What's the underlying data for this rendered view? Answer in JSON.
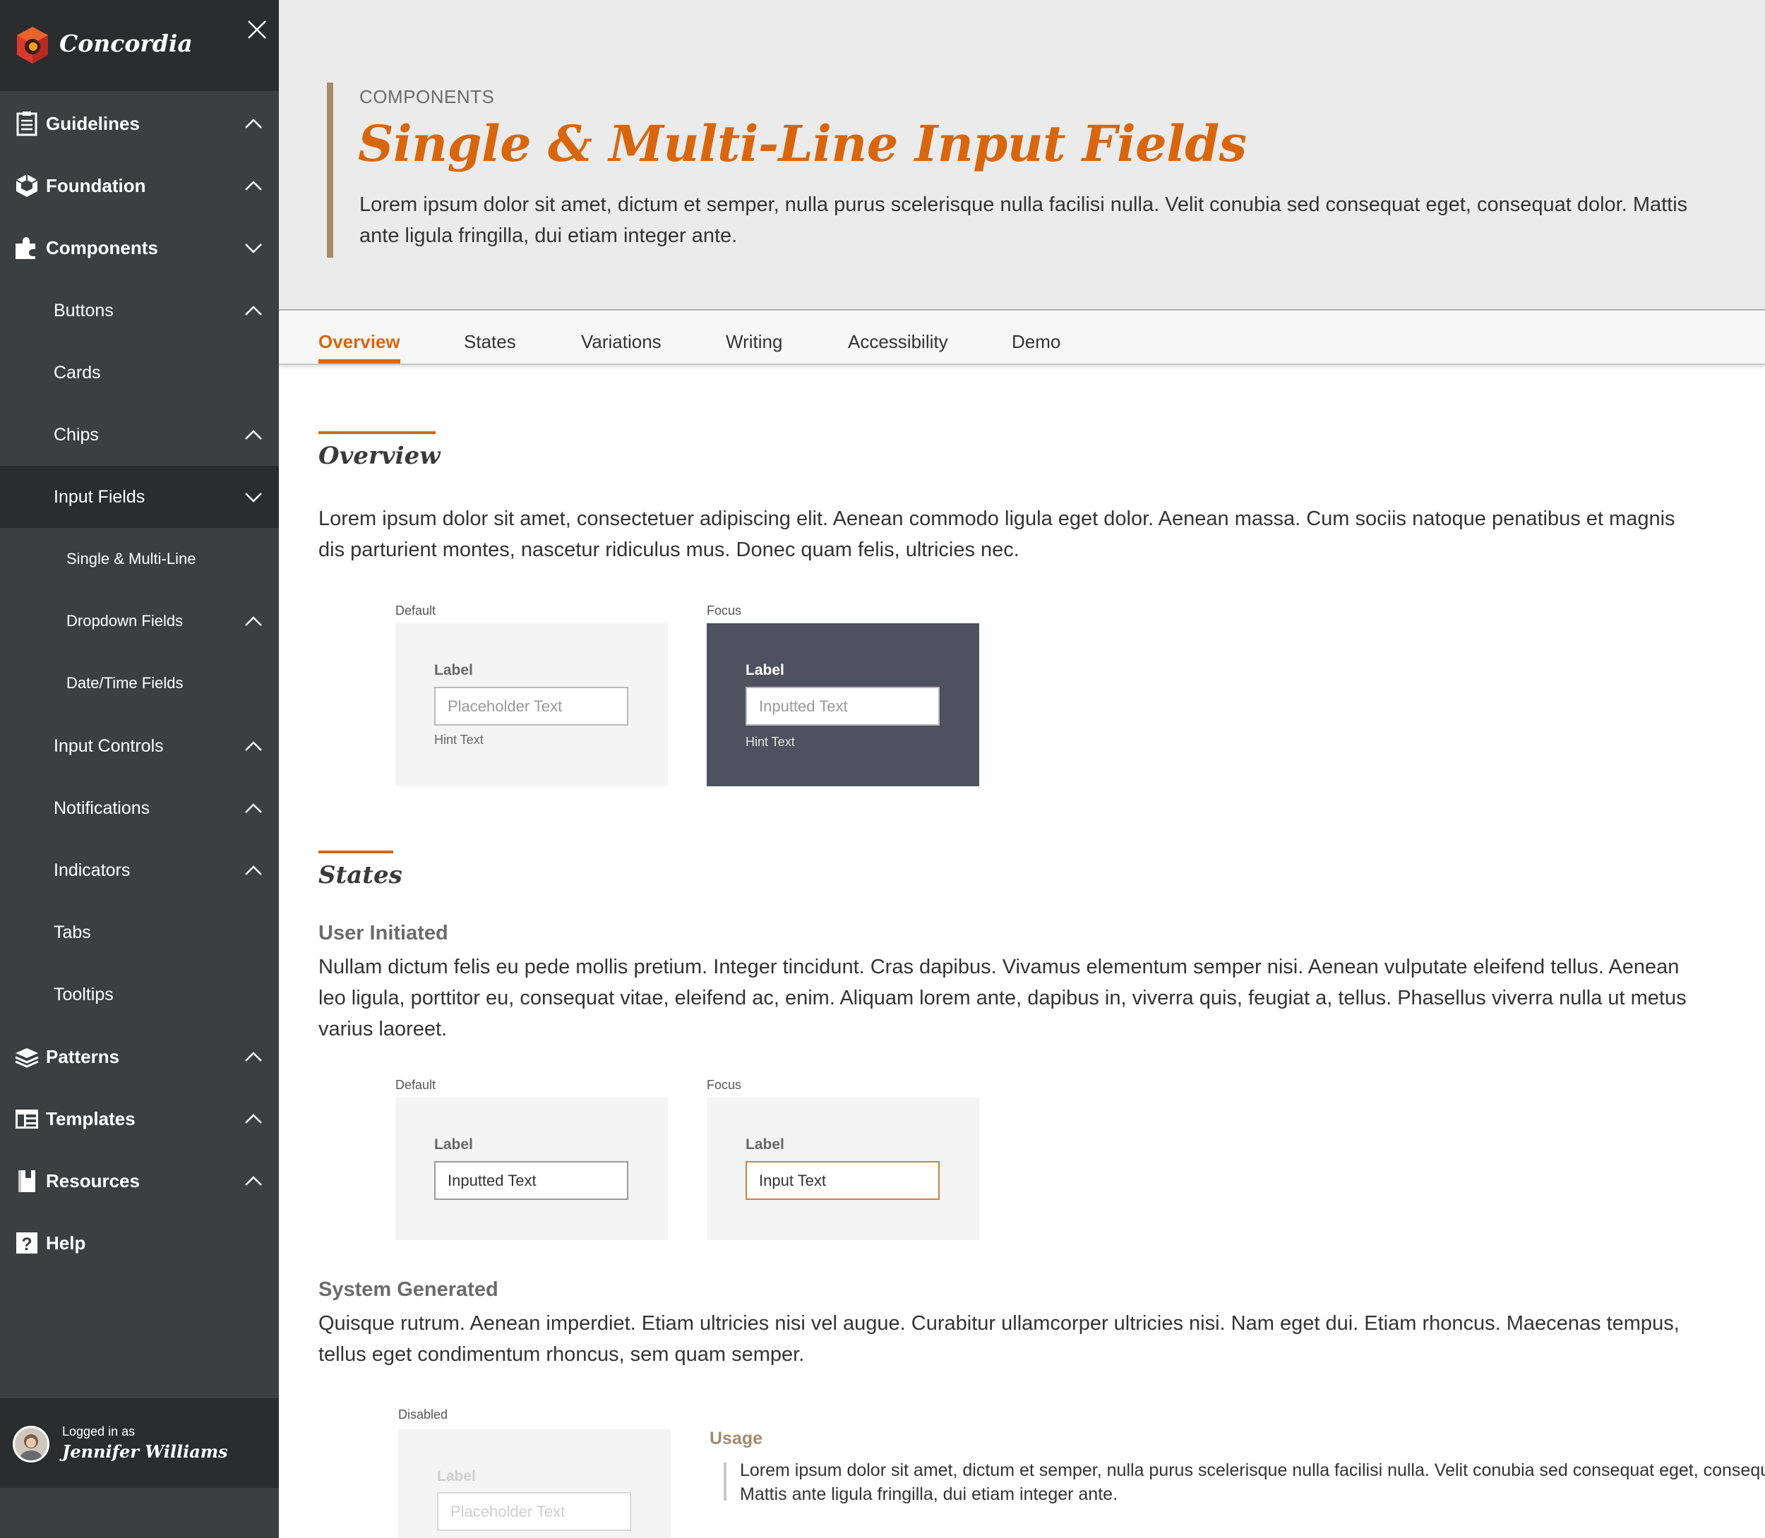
{
  "brand": {
    "name": "Concordia"
  },
  "sidebar": {
    "items": [
      {
        "label": "Guidelines",
        "icon": "clipboard-icon"
      },
      {
        "label": "Foundation",
        "icon": "cube-icon"
      },
      {
        "label": "Components",
        "icon": "puzzle-icon"
      },
      {
        "label": "Buttons"
      },
      {
        "label": "Cards"
      },
      {
        "label": "Chips"
      },
      {
        "label": "Input Fields"
      },
      {
        "label": "Single & Multi-Line"
      },
      {
        "label": "Dropdown Fields"
      },
      {
        "label": "Date/Time Fields"
      },
      {
        "label": "Input Controls"
      },
      {
        "label": "Notifications"
      },
      {
        "label": "Indicators"
      },
      {
        "label": "Tabs"
      },
      {
        "label": "Tooltips"
      },
      {
        "label": "Patterns",
        "icon": "layers-icon"
      },
      {
        "label": "Templates",
        "icon": "template-icon"
      },
      {
        "label": "Resources",
        "icon": "book-icon"
      },
      {
        "label": "Help",
        "icon": "help-icon"
      }
    ],
    "user": {
      "logged_in_label": "Logged in as",
      "name": "Jennifer Williams"
    }
  },
  "hero": {
    "eyebrow": "COMPONENTS",
    "title": "Single & Multi-Line Input Fields",
    "description": "Lorem ipsum dolor sit amet, dictum et semper, nulla purus scelerisque nulla facilisi nulla. Velit conubia sed consequat eget, consequat dolor. Mattis ante ligula fringilla, dui etiam integer ante."
  },
  "tabs": [
    "Overview",
    "States",
    "Variations",
    "Writing",
    "Accessibility",
    "Demo"
  ],
  "overview": {
    "title": "Overview",
    "text": "Lorem ipsum dolor sit amet, consectetuer adipiscing elit. Aenean commodo ligula eget dolor. Aenean massa. Cum sociis natoque penatibus et magnis dis parturient montes, nascetur ridiculus mus. Donec quam felis, ultricies nec.",
    "demos": [
      {
        "caption": "Default",
        "label": "Label",
        "value": "Placeholder Text",
        "hint": "Hint Text"
      },
      {
        "caption": "Focus",
        "label": "Label",
        "value": "Inputted Text",
        "hint": "Hint Text"
      }
    ]
  },
  "states": {
    "title": "States",
    "user_initiated": {
      "title": "User Initiated",
      "text": "Nullam dictum felis eu pede mollis pretium. Integer tincidunt. Cras dapibus. Vivamus elementum semper nisi. Aenean vulputate eleifend tellus. Aenean leo ligula, porttitor eu, consequat vitae, eleifend ac, enim. Aliquam lorem ante, dapibus in, viverra quis, feugiat a, tellus. Phasellus viverra nulla ut metus varius laoreet.",
      "demos": [
        {
          "caption": "Default",
          "label": "Label",
          "value": "Inputted Text"
        },
        {
          "caption": "Focus",
          "label": "Label",
          "value": "Input Text"
        }
      ]
    },
    "system_generated": {
      "title": "System Generated",
      "text": "Quisque rutrum. Aenean imperdiet. Etiam ultricies nisi vel augue. Curabitur ullamcorper ultricies nisi. Nam eget dui. Etiam rhoncus. Maecenas tempus, tellus eget condimentum rhoncus, sem quam semper.",
      "demos": [
        {
          "caption": "Disabled",
          "label": "Label",
          "value": "Placeholder Text"
        }
      ],
      "usage": {
        "title": "Usage",
        "text": "Lorem ipsum dolor sit amet, dictum et semper, nulla purus scelerisque nulla facilisi nulla. Velit conubia sed consequat eget, consequat dolor. Mattis ante ligula fringilla, dui etiam integer ante."
      }
    }
  },
  "colors": {
    "accent": "#d8660f",
    "sidebar": "#3d3e40",
    "sidebar_dark": "#2b2c2e",
    "hero_bg": "#ebebeb",
    "quote_bar": "#a58b6a",
    "focus_box": "#4d525e"
  }
}
